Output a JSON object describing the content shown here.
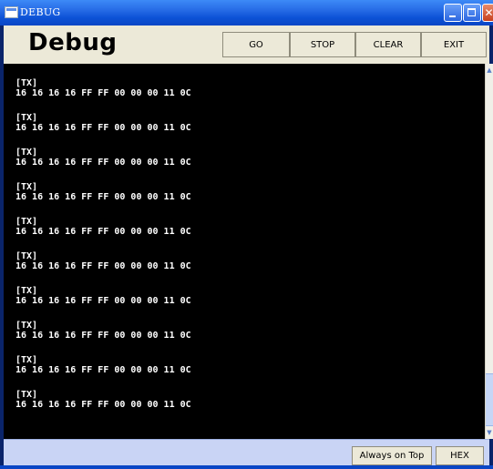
{
  "window": {
    "title": "DEBUG",
    "controls": {
      "minimize": "minimize",
      "maximize": "maximize",
      "close": "close"
    }
  },
  "header": {
    "title": "Debug",
    "buttons": {
      "go": "GO",
      "stop": "STOP",
      "clear": "CLEAR",
      "exit": "EXIT"
    }
  },
  "log": {
    "entries": [
      {
        "tag": "[TX]",
        "bytes": "16 16 16 16 FF FF 00 00 00 11 0C"
      },
      {
        "tag": "[TX]",
        "bytes": "16 16 16 16 FF FF 00 00 00 11 0C"
      },
      {
        "tag": "[TX]",
        "bytes": "16 16 16 16 FF FF 00 00 00 11 0C"
      },
      {
        "tag": "[TX]",
        "bytes": "16 16 16 16 FF FF 00 00 00 11 0C"
      },
      {
        "tag": "[TX]",
        "bytes": "16 16 16 16 FF FF 00 00 00 11 0C"
      },
      {
        "tag": "[TX]",
        "bytes": "16 16 16 16 FF FF 00 00 00 11 0C"
      },
      {
        "tag": "[TX]",
        "bytes": "16 16 16 16 FF FF 00 00 00 11 0C"
      },
      {
        "tag": "[TX]",
        "bytes": "16 16 16 16 FF FF 00 00 00 11 0C"
      },
      {
        "tag": "[TX]",
        "bytes": "16 16 16 16 FF FF 00 00 00 11 0C"
      },
      {
        "tag": "[TX]",
        "bytes": "16 16 16 16 FF FF 00 00 00 11 0C"
      }
    ]
  },
  "footer": {
    "buttons": {
      "always_on_top": "Always on Top",
      "hex": "HEX"
    }
  },
  "colors": {
    "titlebar": "#0c52d6",
    "console_bg": "#000000",
    "console_text": "#ffffff",
    "footer_bg": "#c9d4f5"
  }
}
